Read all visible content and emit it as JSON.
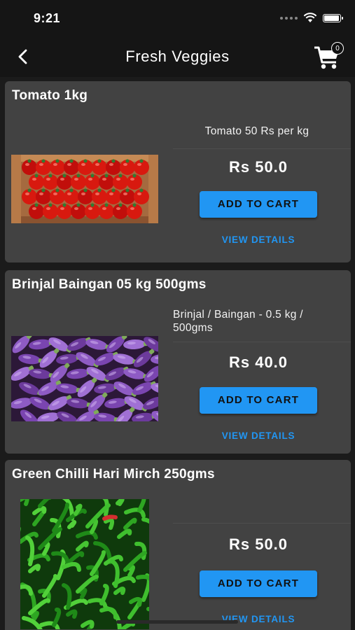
{
  "status_bar": {
    "time": "9:21",
    "battery_level": 0.95
  },
  "header": {
    "back_icon": "chevron-left-icon",
    "title": "Fresh Veggies",
    "cart_icon": "shopping-cart-icon",
    "cart_count": "0"
  },
  "products": [
    {
      "title": "Tomato 1kg",
      "description": "Tomato 50 Rs per kg",
      "price": "Rs 50.0",
      "add_label": "ADD TO CART",
      "details_label": "VIEW DETAILS",
      "image": "tomatoes-crate-image"
    },
    {
      "title": "Brinjal Baingan 05 kg 500gms",
      "description": "Brinjal / Baingan - 0.5 kg / 500gms",
      "price": "Rs 40.0",
      "add_label": "ADD TO CART",
      "details_label": "VIEW DETAILS",
      "image": "brinjal-pile-image"
    },
    {
      "title": "Green Chilli Hari Mirch 250gms",
      "description": "",
      "price": "Rs 50.0",
      "add_label": "ADD TO CART",
      "details_label": "VIEW DETAILS",
      "image": "green-chilli-pile-image"
    }
  ],
  "colors": {
    "accent": "#2196f3",
    "card": "#424242",
    "background": "#1b1b1b"
  }
}
